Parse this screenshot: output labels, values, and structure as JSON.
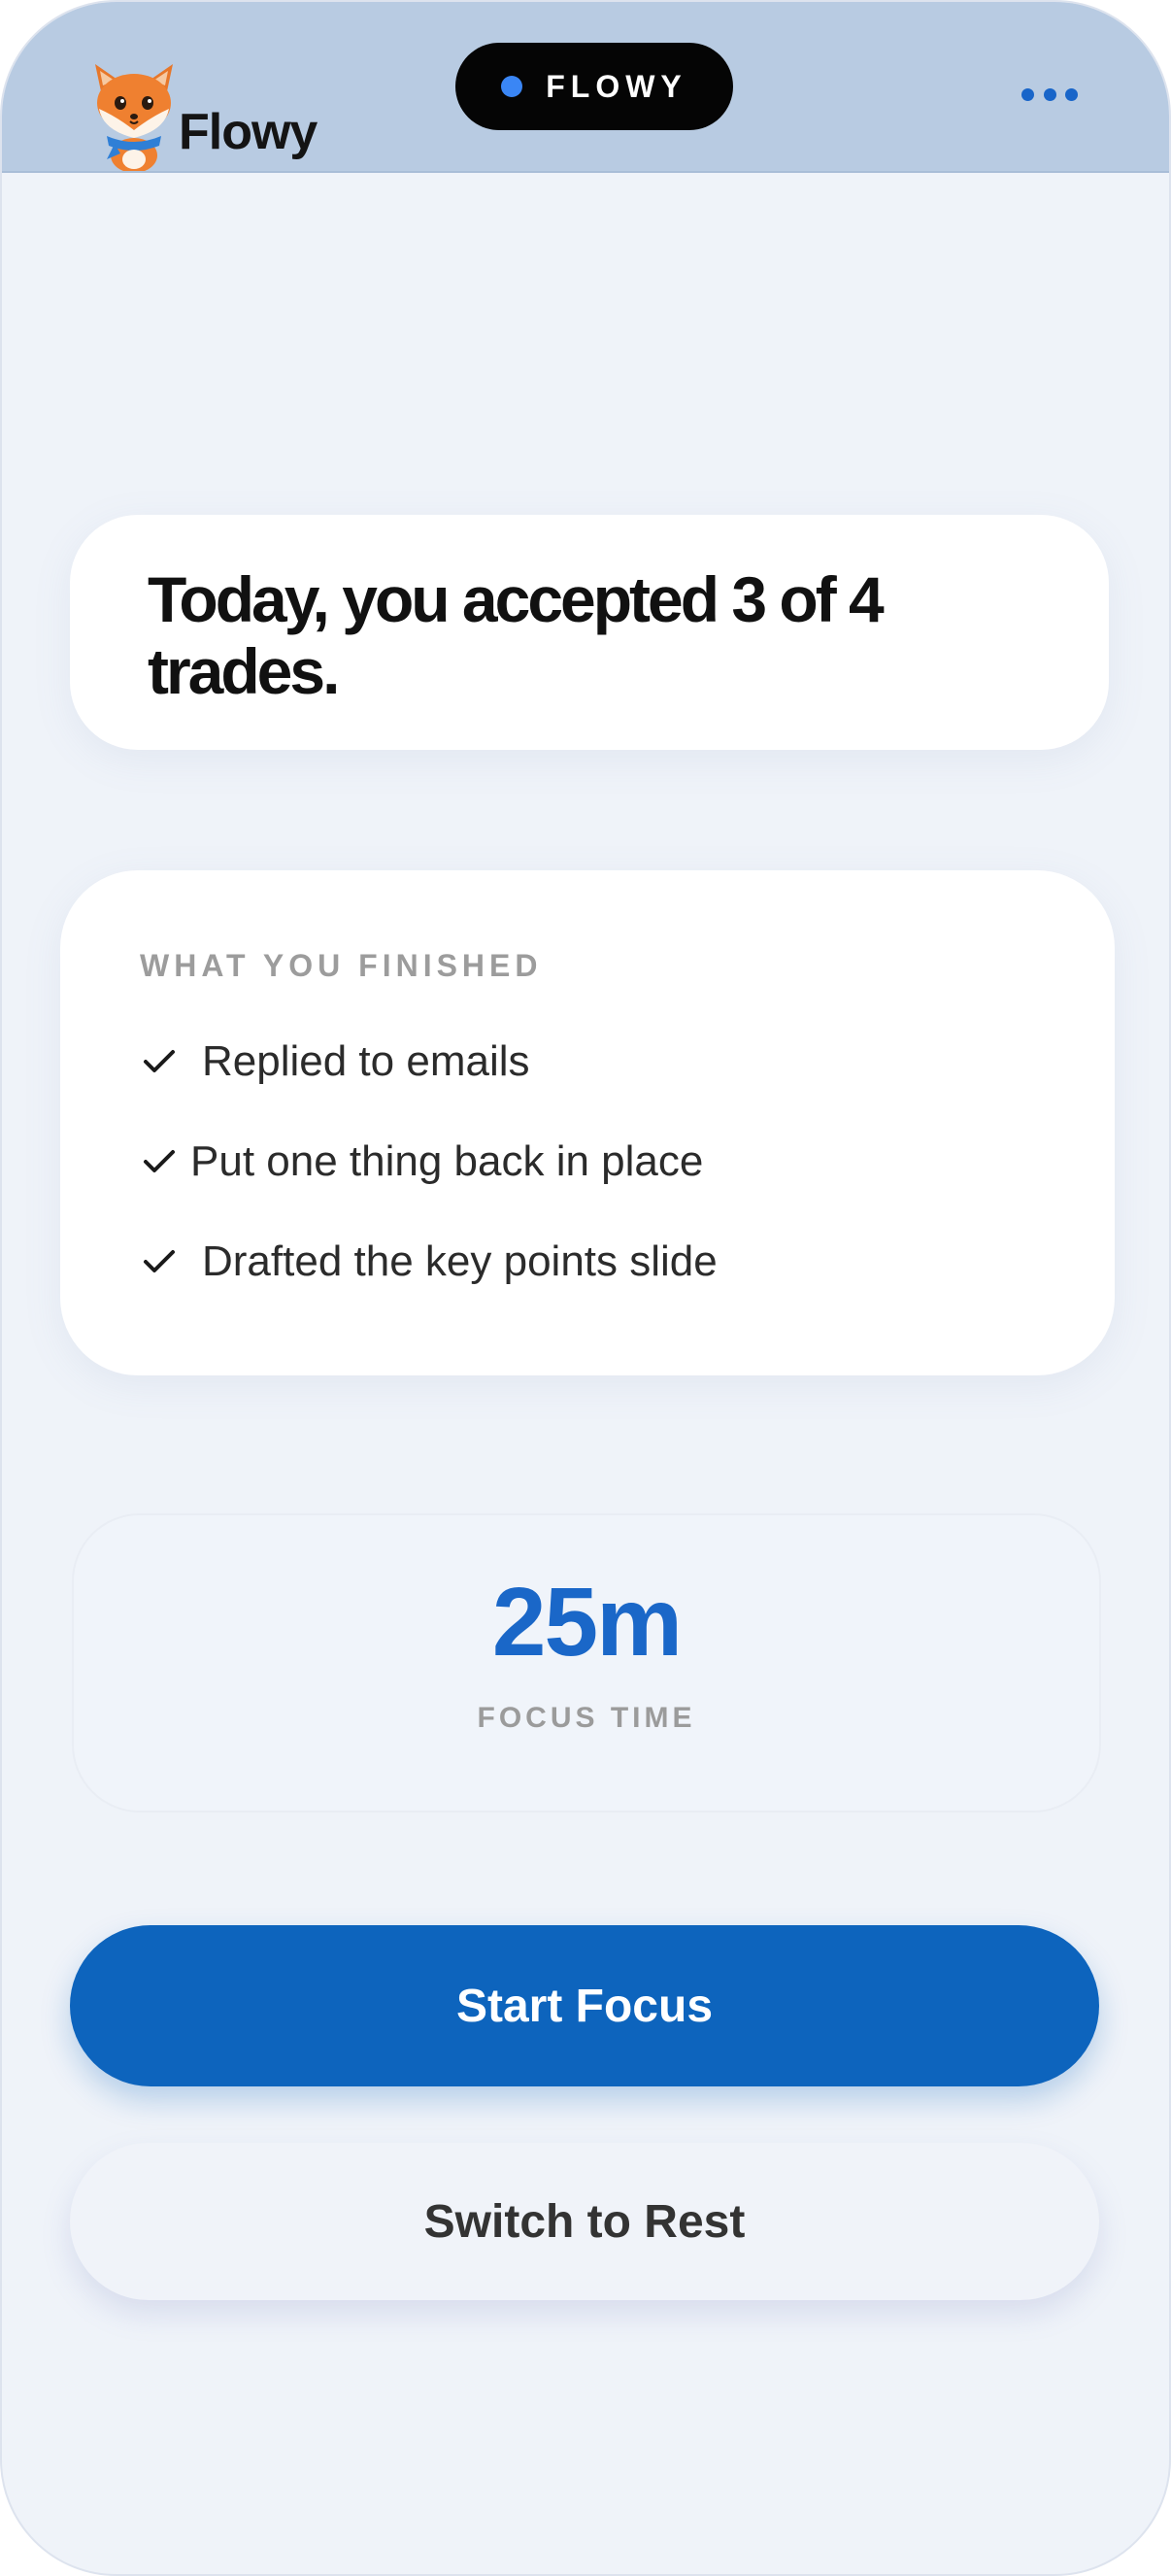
{
  "app": {
    "brand": "Flowy",
    "island_label": "FLOWY",
    "accent_color": "#0d64bd"
  },
  "header": {
    "logo_icon": "fox-mascot-icon",
    "menu_icon": "more-dots-icon"
  },
  "summary": {
    "text": "Today, you accepted 3 of 4 trades."
  },
  "finished": {
    "title": "WHAT YOU FINISHED",
    "items": [
      {
        "label": "Replied to emails"
      },
      {
        "label": "Put one thing back in place"
      },
      {
        "label": "Drafted the key points slide"
      }
    ]
  },
  "focus": {
    "value": "25m",
    "label": "FOCUS TIME"
  },
  "actions": {
    "primary_label": "Start Focus",
    "secondary_label": "Switch to Rest"
  }
}
